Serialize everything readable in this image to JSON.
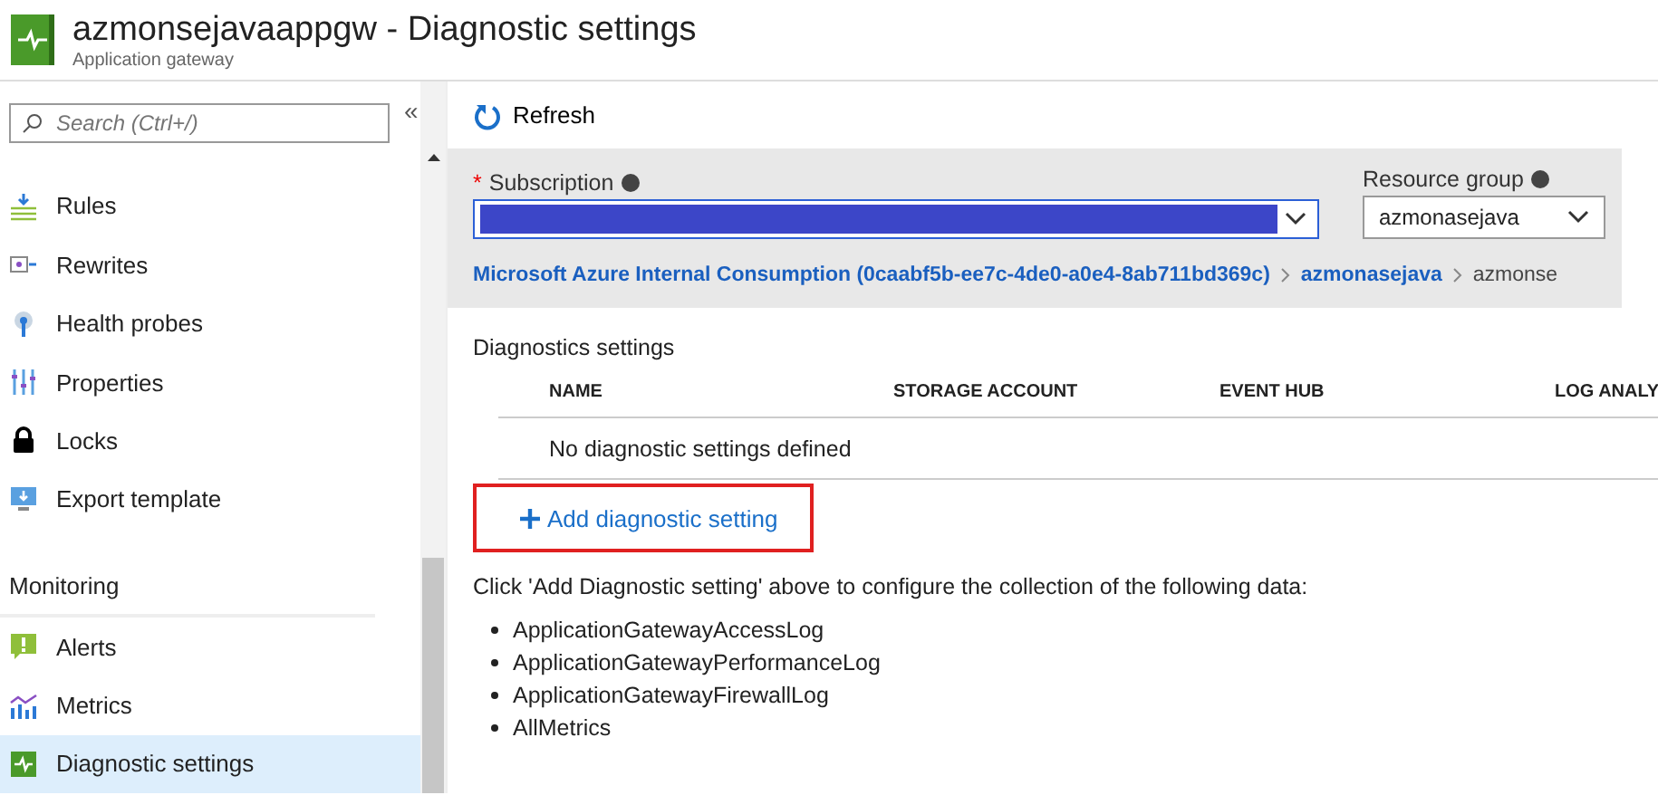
{
  "header": {
    "title": "azmonsejavaappgw - Diagnostic settings",
    "subtitle": "Application gateway"
  },
  "sidebar": {
    "search": {
      "placeholder": "Search (Ctrl+/)"
    },
    "collapse": "«",
    "items": [
      {
        "kind": "rules",
        "label": "Rules",
        "selected": false
      },
      {
        "kind": "rewrites",
        "label": "Rewrites",
        "selected": false
      },
      {
        "kind": "probe",
        "label": "Health probes",
        "selected": false
      },
      {
        "kind": "properties",
        "label": "Properties",
        "selected": false
      },
      {
        "kind": "lock",
        "label": "Locks",
        "selected": false
      },
      {
        "kind": "export",
        "label": "Export template",
        "selected": false
      },
      {
        "kind": "section",
        "label": "Monitoring"
      },
      {
        "kind": "alert",
        "label": "Alerts",
        "selected": false
      },
      {
        "kind": "metrics",
        "label": "Metrics",
        "selected": false
      },
      {
        "kind": "diagnostic",
        "label": "Diagnostic settings",
        "selected": true
      }
    ]
  },
  "toolbar": {
    "refresh": "Refresh"
  },
  "filters": {
    "subscription": {
      "label": "Subscription",
      "required_mark": "*"
    },
    "resource_group": {
      "label": "Resource group",
      "value": "azmonasejava"
    },
    "breadcrumb": [
      {
        "text": "Microsoft Azure Internal Consumption (0caabf5b-ee7c-4de0-a0e4-8ab711bd369c)",
        "link": true
      },
      {
        "text": "azmonasejava",
        "link": true
      },
      {
        "text": "azmonse",
        "link": false
      }
    ]
  },
  "diagnostics": {
    "title": "Diagnostics settings",
    "columns": [
      "NAME",
      "STORAGE ACCOUNT",
      "EVENT HUB",
      "LOG ANALY"
    ],
    "empty": "No diagnostic settings defined",
    "add": "Add diagnostic setting",
    "hint": "Click 'Add Diagnostic setting' above to configure the collection of the following data:",
    "data": [
      "ApplicationGatewayAccessLog",
      "ApplicationGatewayPerformanceLog",
      "ApplicationGatewayFirewallLog",
      "AllMetrics"
    ]
  }
}
